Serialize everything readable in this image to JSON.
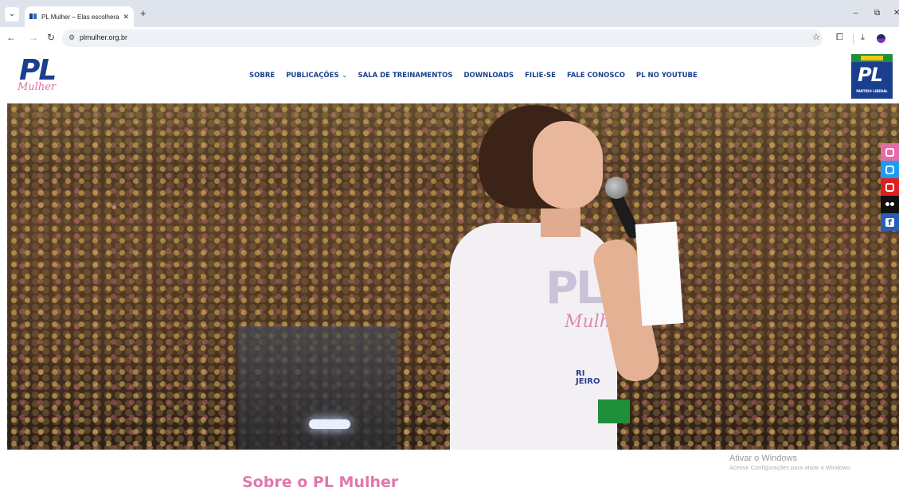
{
  "browser": {
    "tab_title": "PL Mulher – Elas escolheram fa...",
    "tab_close": "✕",
    "new_tab": "+",
    "url": "plmulher.org.br",
    "colors": {
      "tabstrip": "#dfe3ec",
      "omnibox": "#eef1f6"
    }
  },
  "header": {
    "logo_main": "PL",
    "logo_script": "Mulher",
    "nav": [
      {
        "label": "SOBRE"
      },
      {
        "label": "PUBLICAÇÕES"
      },
      {
        "label": "SALA DE TREINAMENTOS"
      },
      {
        "label": "DOWNLOADS"
      },
      {
        "label": "FILIE-SE"
      },
      {
        "label": "FALE CONOSCO"
      },
      {
        "label": "PL NO YOUTUBE"
      }
    ],
    "party_logo_main": "PL",
    "party_logo_sub": "PARTIDO LIBERAL"
  },
  "hero": {
    "shirt_text": "PL",
    "shirt_script": "Mulher",
    "shirt_small": "RI\nJEIRO"
  },
  "social": [
    "instagram-icon",
    "twitter-icon",
    "youtube-icon",
    "flickr-icon",
    "facebook-icon"
  ],
  "main": {
    "section_title": "Sobre o PL Mulher"
  },
  "windows_activation": {
    "title": "Ativar o Windows",
    "subtitle": "Acesse Configurações para ativar o Windows."
  },
  "colors": {
    "brand_blue": "#1b3f8f",
    "brand_pink": "#e078b0"
  }
}
